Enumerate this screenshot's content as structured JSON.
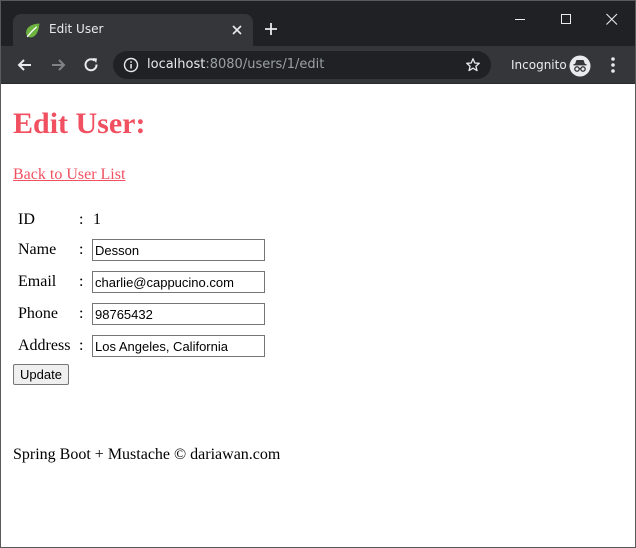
{
  "browser": {
    "tab_title": "Edit User",
    "url_host": "localhost",
    "url_rest": ":8080/users/1/edit",
    "incognito_label": "Incognito",
    "colors": {
      "tabstrip": "#202124",
      "toolbar": "#35363a",
      "omnibox": "#202124",
      "favicon": "#6db33f"
    },
    "icons": [
      "spring-leaf-icon",
      "close-icon",
      "plus-icon",
      "minimize-icon",
      "maximize-icon",
      "window-close-icon",
      "back-arrow-icon",
      "forward-arrow-icon",
      "reload-icon",
      "info-icon",
      "star-icon",
      "incognito-icon",
      "kebab-menu-icon"
    ]
  },
  "page": {
    "title": "Edit User:",
    "back_link": "Back to User List",
    "accent_color": "#f05060",
    "form": {
      "colon": ":",
      "id": {
        "label": "ID",
        "value": "1"
      },
      "name": {
        "label": "Name",
        "value": "Desson"
      },
      "email": {
        "label": "Email",
        "value": "charlie@cappucino.com"
      },
      "phone": {
        "label": "Phone",
        "value": "98765432"
      },
      "address": {
        "label": "Address",
        "value": "Los Angeles, California"
      },
      "submit_label": "Update"
    },
    "footer": "Spring Boot + Mustache © dariawan.com"
  }
}
